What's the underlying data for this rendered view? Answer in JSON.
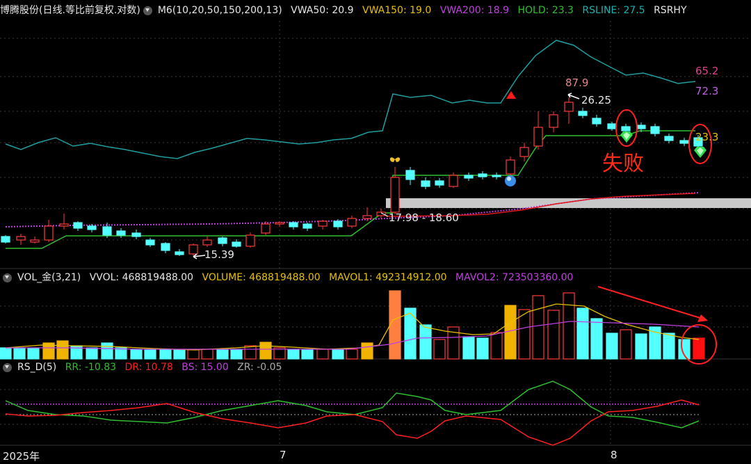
{
  "main_header": {
    "title": "博腾股份(日线.等比前复权.对数)",
    "indicator": "M6(10,20,50,150,200,13)",
    "vwa50": "VWA50: 20.9",
    "vwa150": "VWA150: 19.0",
    "vwa200": "VWA200: 18.9",
    "hold": "HOLD: 23.3",
    "rsline": "RSLINE: 27.5",
    "rsrhy": "RSRHY"
  },
  "vol_header": {
    "name": "VOL_金(3,21)",
    "vvol": "VVOL: 468819488.00",
    "volume": "VOLUME: 468819488.00",
    "mavol1": "MAVOL1: 492314912.00",
    "mavol2": "MAVOL2: 723503360.00"
  },
  "rs_header": {
    "name": "RS_D(5)",
    "rr": "RR: -10.83",
    "dr": "DR: 10.78",
    "bs": "BS: 15.00",
    "zr": "ZR: -0.05"
  },
  "price_labels": {
    "high_87": "87.9",
    "high_26": "26.25",
    "low_15": "15.39",
    "range": "17.98 - 18.60",
    "right_65": "65.2",
    "right_72": "72.3",
    "right_23": "23.3"
  },
  "annotation": "失败",
  "x_axis": [
    "2025年",
    "7",
    "8"
  ],
  "colors": {
    "up": "#ff3b3b",
    "down": "#54ffff",
    "teal": "#1e9e9e",
    "hold_green": "#2fbf2f",
    "magenta": "#c040e0",
    "yellow": "#e8c000",
    "red_line": "#e01818",
    "annotation": "#ff2a1a"
  },
  "icons": [
    "chevron-down-icon",
    "butterfly-icon",
    "red-triangle-icon",
    "blue-ball-icon",
    "green-gem-icon"
  ]
}
